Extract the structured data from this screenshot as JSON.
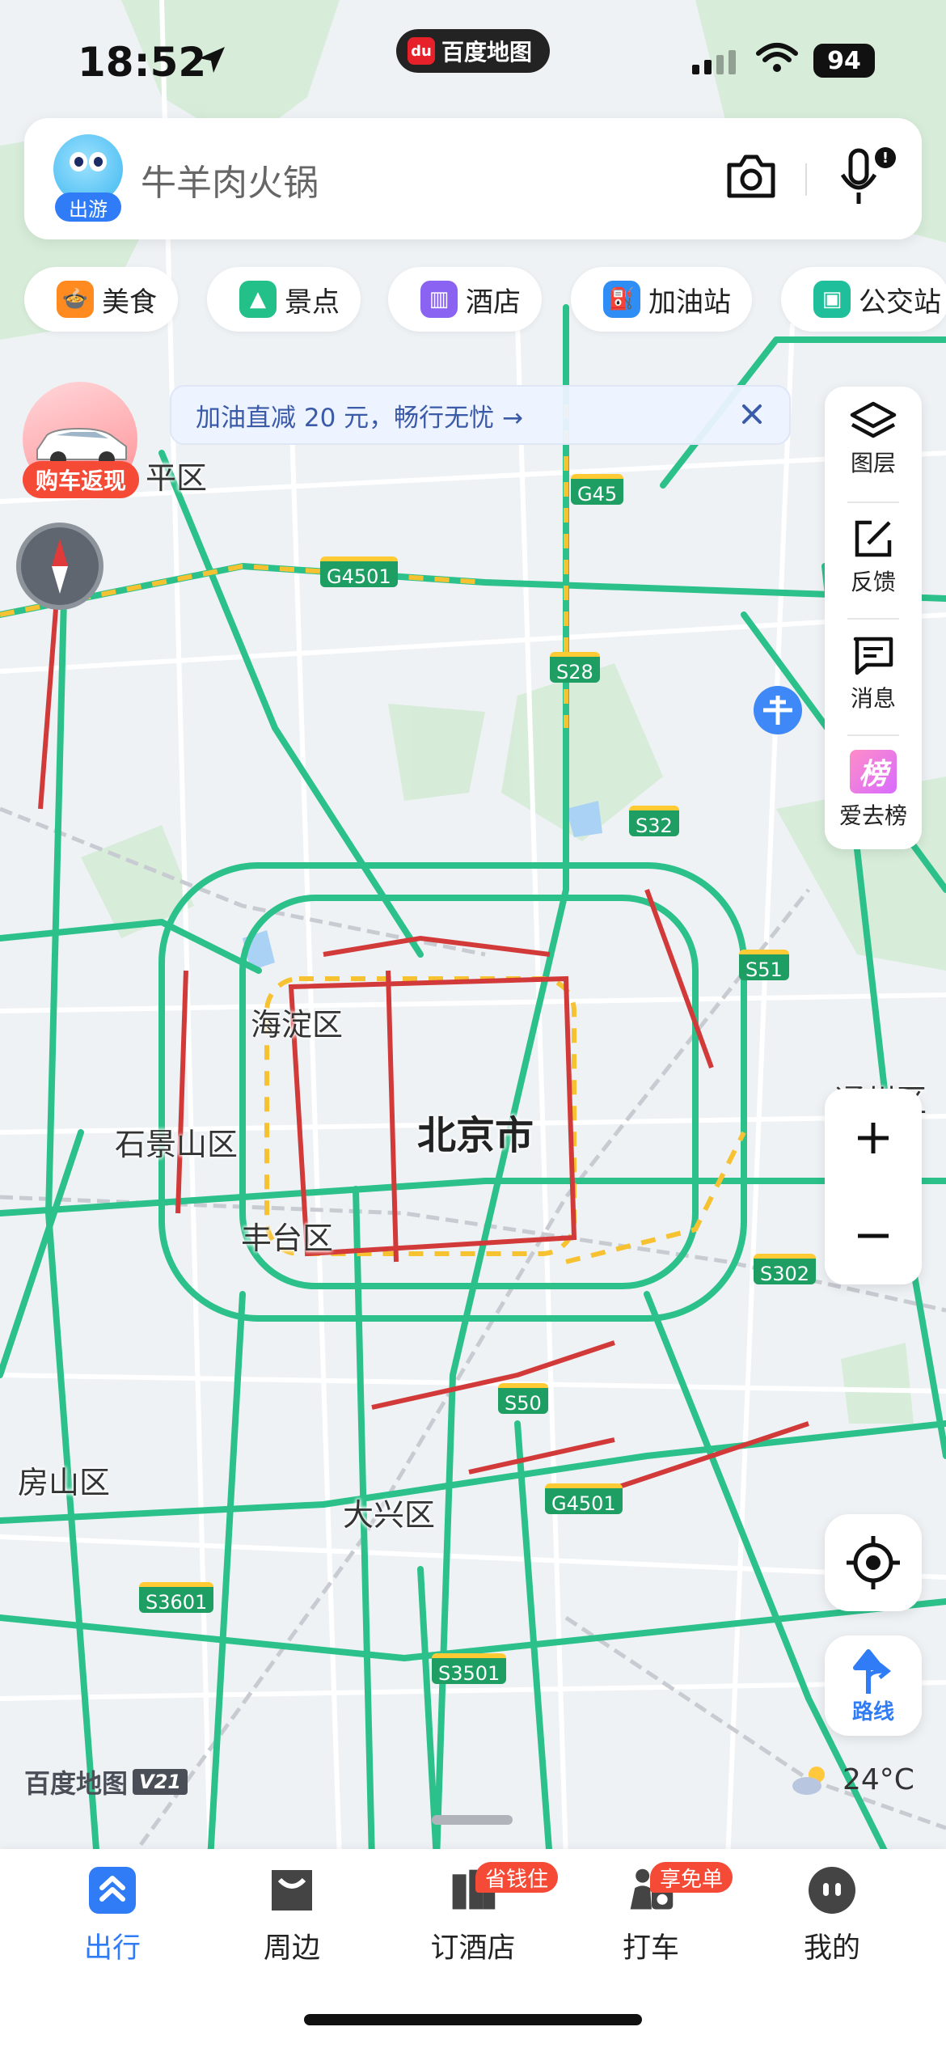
{
  "status_bar": {
    "time": "18:52",
    "battery": "94"
  },
  "app_pill": {
    "label": "百度地图"
  },
  "search": {
    "query": "牛羊肉火锅",
    "avatar_badge": "出游"
  },
  "categories": [
    {
      "label": "美食",
      "icon": "food-icon",
      "color": "#ff8a1f"
    },
    {
      "label": "景点",
      "icon": "scenery-icon",
      "color": "#23c08a"
    },
    {
      "label": "酒店",
      "icon": "hotel-icon",
      "color": "#8a63f2"
    },
    {
      "label": "加油站",
      "icon": "gas-station-icon",
      "color": "#2f8df6"
    },
    {
      "label": "公交站",
      "icon": "bus-stop-icon",
      "color": "#1fbf9b"
    }
  ],
  "promo": {
    "text": "加油直减 20 元，畅行无忧 →"
  },
  "car_promo": {
    "label": "购车返现"
  },
  "side_panel": {
    "layers": "图层",
    "feedback": "反馈",
    "messages": "消息",
    "ranking": "爱去榜",
    "ranking_icon_text": "榜"
  },
  "map": {
    "city": "北京市",
    "districts": [
      "海淀区",
      "石景山区",
      "丰台区",
      "房山区",
      "大兴区",
      "平区",
      "通州区"
    ],
    "roads": [
      "G45",
      "G4501",
      "S28",
      "S32",
      "S51",
      "S302",
      "S50",
      "G4501",
      "S3601",
      "S3501"
    ]
  },
  "route_button": {
    "label": "路线"
  },
  "watermark": {
    "brand": "百度地图",
    "version": "V21"
  },
  "weather": {
    "temperature": "24°C"
  },
  "tabs": [
    {
      "label": "出行",
      "active": true
    },
    {
      "label": "周边",
      "active": false
    },
    {
      "label": "订酒店",
      "active": false,
      "badge": "省钱住"
    },
    {
      "label": "打车",
      "active": false,
      "badge": "享免单"
    },
    {
      "label": "我的",
      "active": false
    }
  ],
  "colors": {
    "accent": "#2f7cf6",
    "road_green": "#2cc18a",
    "traffic_red": "#d23a3a",
    "traffic_yellow": "#f7c232",
    "badge_red": "#f44a36"
  }
}
